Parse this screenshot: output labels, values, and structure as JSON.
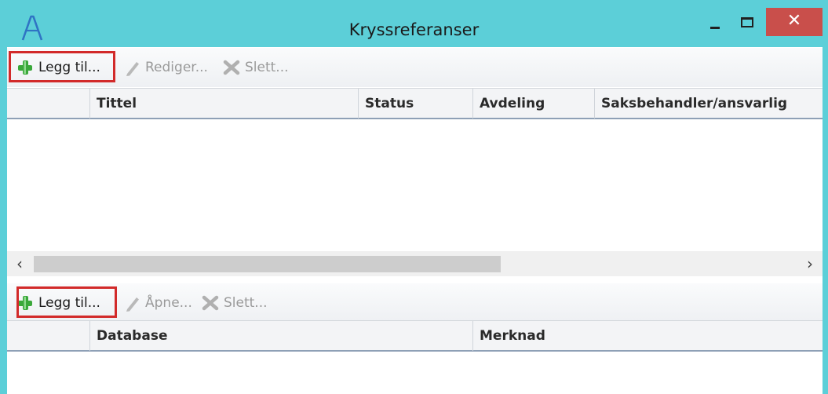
{
  "window": {
    "title": "Kryssreferanser",
    "accent_color": "#5ccfd8",
    "close_color": "#c94f4b",
    "icons": {
      "app": "app-logo-icon",
      "minimize": "minimize-icon",
      "maximize": "maximize-icon",
      "close": "close-icon"
    },
    "close_glyph": "✕"
  },
  "top_toolbar": {
    "add_label": "Legg til...",
    "edit_label": "Rediger...",
    "delete_label": "Slett...",
    "icons": {
      "add": "green-plus-icon",
      "edit": "pencil-icon",
      "delete": "gray-x-icon"
    },
    "highlight_color": "#d22a2a"
  },
  "top_grid": {
    "columns": [
      "",
      "Tittel",
      "Status",
      "Avdeling",
      "Saksbehandler/ansvarlig"
    ],
    "rows": []
  },
  "scrollbar": {
    "left_arrow": "‹",
    "right_arrow": "›"
  },
  "bottom_toolbar": {
    "add_label": "Legg til...",
    "open_label": "Åpne...",
    "delete_label": "Slett...",
    "icons": {
      "add": "green-plus-icon",
      "open": "pencil-icon",
      "delete": "gray-x-icon"
    }
  },
  "bottom_grid": {
    "columns": [
      "",
      "Database",
      "Merknad"
    ],
    "rows": []
  }
}
